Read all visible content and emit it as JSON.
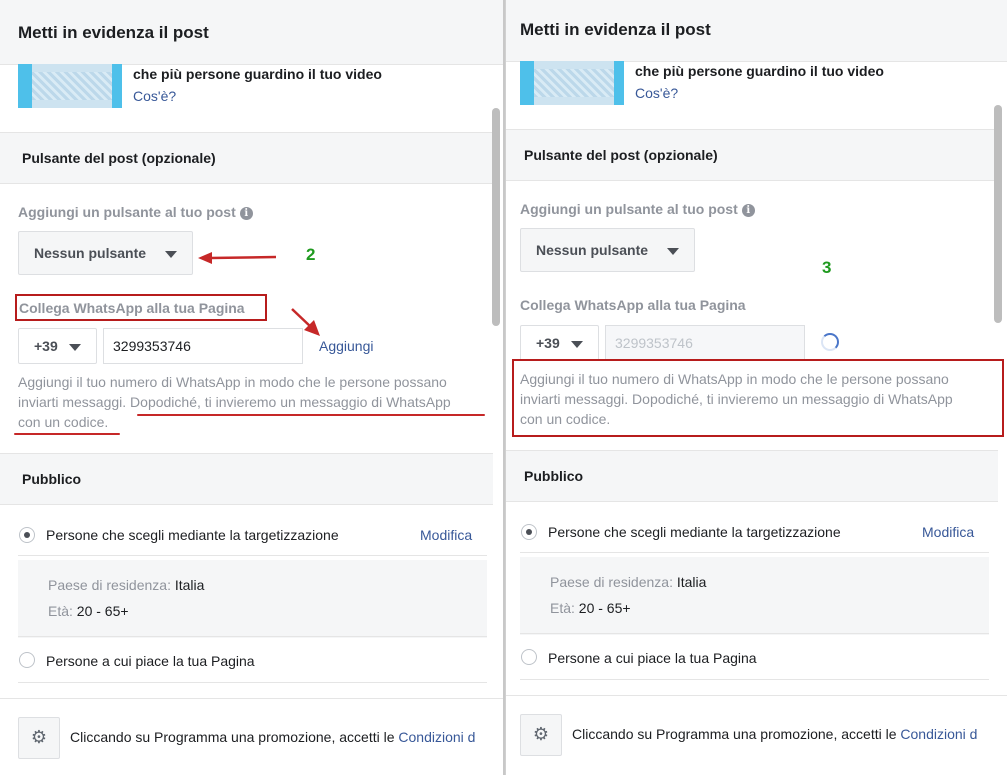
{
  "left": {
    "title": "Metti in evidenza il post",
    "promo_text": "che più persone guardino il tuo video",
    "whats_link": "Cos'è?",
    "section_button": "Pulsante del post (opzionale)",
    "add_button_label": "Aggiungi un pulsante al tuo post",
    "dropdown_value": "Nessun pulsante",
    "step": "2",
    "whatsapp_label": "Collega WhatsApp alla tua Pagina",
    "country_code": "+39",
    "phone_value": "3299353746",
    "add_link": "Aggiungi",
    "help_line1": "Aggiungi il tuo numero di WhatsApp in modo che le persone possano",
    "help_line2": "inviarti messaggi. Dopodiché, ti invieremo un messaggio di WhatsApp",
    "help_line3": "con un codice.",
    "section_audience": "Pubblico",
    "audience_option1": "Persone che scegli mediante la targetizzazione",
    "edit_link": "Modifica",
    "country_label": "Paese di residenza:",
    "country_value": "Italia",
    "age_label": "Età:",
    "age_value": "20 - 65+",
    "audience_option2": "Persone a cui piace la tua Pagina",
    "footer_text": "Cliccando su Programma una promozione, accetti le",
    "footer_link": "Condizioni d"
  },
  "right": {
    "title": "Metti in evidenza il post",
    "promo_text": "che più persone guardino il tuo video",
    "whats_link": "Cos'è?",
    "section_button": "Pulsante del post (opzionale)",
    "add_button_label": "Aggiungi un pulsante al tuo post",
    "dropdown_value": "Nessun pulsante",
    "step": "3",
    "whatsapp_label": "Collega WhatsApp alla tua Pagina",
    "country_code": "+39",
    "phone_value": "3299353746",
    "help_line1": "Aggiungi il tuo numero di WhatsApp in modo che le persone possano",
    "help_line2": "inviarti messaggi. Dopodiché, ti invieremo un messaggio di WhatsApp",
    "help_line3": "con un codice.",
    "section_audience": "Pubblico",
    "audience_option1": "Persone che scegli mediante la targetizzazione",
    "edit_link": "Modifica",
    "country_label": "Paese di residenza:",
    "country_value": "Italia",
    "age_label": "Età:",
    "age_value": "20 - 65+",
    "audience_option2": "Persone a cui piace la tua Pagina",
    "footer_text": "Cliccando su Programma una promozione, accetti le",
    "footer_link": "Condizioni d"
  },
  "colors": {
    "link": "#385898",
    "annotation_red": "#b71c1c",
    "step_green": "#1f9a1f"
  },
  "icons": {
    "info": "info-icon",
    "caret": "caret-down-icon",
    "gear": "gear-icon",
    "spinner": "loading-spinner-icon",
    "arrow": "red-arrow-icon"
  }
}
